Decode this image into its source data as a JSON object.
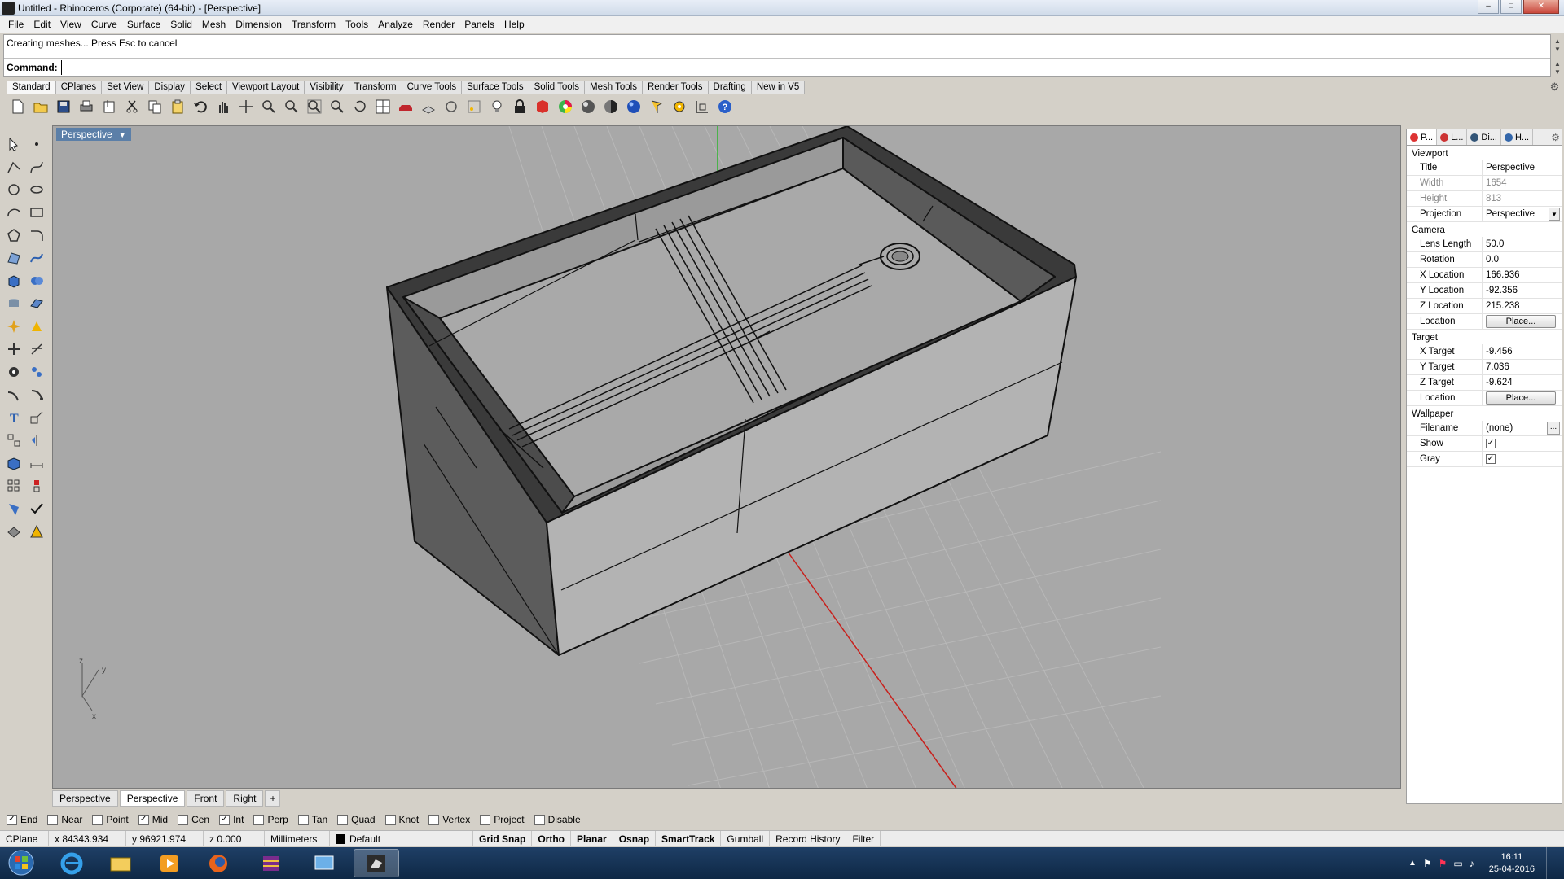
{
  "window": {
    "title": "Untitled - Rhinoceros (Corporate) (64-bit) - [Perspective]",
    "minimize": "–",
    "maximize": "□",
    "close": "✕"
  },
  "menu": [
    "File",
    "Edit",
    "View",
    "Curve",
    "Surface",
    "Solid",
    "Mesh",
    "Dimension",
    "Transform",
    "Tools",
    "Analyze",
    "Render",
    "Panels",
    "Help"
  ],
  "command": {
    "history": "Creating meshes... Press Esc to cancel",
    "prompt_label": "Command:",
    "input_value": ""
  },
  "toolbar_tabs": [
    "Standard",
    "CPlanes",
    "Set View",
    "Display",
    "Select",
    "Viewport Layout",
    "Visibility",
    "Transform",
    "Curve Tools",
    "Surface Tools",
    "Solid Tools",
    "Mesh Tools",
    "Render Tools",
    "Drafting",
    "New in V5"
  ],
  "toolbar_icons": [
    "new-file-icon",
    "open-file-icon",
    "save-icon",
    "print-icon",
    "import-icon",
    "cut-icon",
    "copy-icon",
    "paste-icon",
    "undo-icon",
    "pan-hand-icon",
    "move-view-icon",
    "zoom-window-icon",
    "zoom-dynamic-icon",
    "zoom-extents-icon",
    "zoom-selected-icon",
    "rotate-view-icon",
    "four-viewports-icon",
    "car-icon",
    "grid-icon",
    "circle-icon",
    "points-icon",
    "light-bulb-icon",
    "lock-icon",
    "layer-book-icon",
    "color-wheel-icon",
    "shade-sphere-icon",
    "render-sphere-icon",
    "blue-sphere-icon",
    "flag-icon",
    "gear-settings-icon",
    "grid-snap-icon",
    "help-icon"
  ],
  "left_toolbar_icons": [
    [
      "select-arrow-icon",
      "point-icon"
    ],
    [
      "polyline-icon",
      "curve-icon"
    ],
    [
      "circle-tool-icon",
      "ellipse-icon"
    ],
    [
      "arc-icon",
      "rectangle-icon"
    ],
    [
      "polygon-icon",
      "fillet-curve-icon"
    ],
    [
      "surface-icon",
      "loft-icon"
    ],
    [
      "box-icon",
      "union-icon"
    ],
    [
      "cylinder-icon",
      "plane-icon"
    ],
    [
      "explode-icon",
      "burst-icon"
    ],
    [
      "split-icon",
      "trim-icon"
    ],
    [
      "boolean-icon",
      "array-icon"
    ],
    [
      "sweep-icon",
      "revolve-icon"
    ],
    [
      "text-icon",
      "scale-icon"
    ],
    [
      "group-icon",
      "mirror-icon"
    ],
    [
      "mesh-icon",
      "dimension-icon"
    ],
    [
      "array-grid-icon",
      "orient-icon"
    ],
    [
      "analyze-icon",
      "check-icon"
    ],
    [
      "render-icon",
      "shade-icon"
    ]
  ],
  "viewport": {
    "label": "Perspective",
    "dropdown": "▼",
    "axis_z": "z",
    "axis_y": "y",
    "axis_x": "x"
  },
  "viewport_tabs": [
    "Perspective",
    "Perspective",
    "Front",
    "Right"
  ],
  "viewport_tab_add": "+",
  "panel": {
    "tabs": [
      {
        "label": "P...",
        "color": "#d33"
      },
      {
        "label": "L...",
        "color": "#c33"
      },
      {
        "label": "Di...",
        "color": "#357"
      },
      {
        "label": "H...",
        "color": "#36a"
      }
    ],
    "sections": {
      "viewport": "Viewport",
      "camera": "Camera",
      "target": "Target",
      "wallpaper": "Wallpaper"
    },
    "viewport_props": {
      "title_label": "Title",
      "title_value": "Perspective",
      "width_label": "Width",
      "width_value": "1654",
      "height_label": "Height",
      "height_value": "813",
      "projection_label": "Projection",
      "projection_value": "Perspective"
    },
    "camera_props": {
      "lens_label": "Lens Length",
      "lens_value": "50.0",
      "rotation_label": "Rotation",
      "rotation_value": "0.0",
      "xloc_label": "X Location",
      "xloc_value": "166.936",
      "yloc_label": "Y Location",
      "yloc_value": "-92.356",
      "zloc_label": "Z Location",
      "zloc_value": "215.238",
      "location_label": "Location",
      "place_button": "Place..."
    },
    "target_props": {
      "xt_label": "X Target",
      "xt_value": "-9.456",
      "yt_label": "Y Target",
      "yt_value": "7.036",
      "zt_label": "Z Target",
      "zt_value": "-9.624",
      "location_label": "Location",
      "place_button": "Place..."
    },
    "wallpaper_props": {
      "filename_label": "Filename",
      "filename_value": "(none)",
      "browse_button": "...",
      "show_label": "Show",
      "show_checked": "✓",
      "gray_label": "Gray",
      "gray_checked": "✓"
    }
  },
  "osnap": [
    {
      "label": "End",
      "check": "✓"
    },
    {
      "label": "Near",
      "check": ""
    },
    {
      "label": "Point",
      "check": ""
    },
    {
      "label": "Mid",
      "check": "✓"
    },
    {
      "label": "Cen",
      "check": ""
    },
    {
      "label": "Int",
      "check": "✓"
    },
    {
      "label": "Perp",
      "check": ""
    },
    {
      "label": "Tan",
      "check": ""
    },
    {
      "label": "Quad",
      "check": ""
    },
    {
      "label": "Knot",
      "check": ""
    },
    {
      "label": "Vertex",
      "check": ""
    },
    {
      "label": "Project",
      "check": ""
    },
    {
      "label": "Disable",
      "check": ""
    }
  ],
  "status": {
    "cplane": "CPlane",
    "x": "x 84343.934",
    "y": "y 96921.974",
    "z": "z 0.000",
    "units": "Millimeters",
    "layer": "Default",
    "grid_snap": "Grid Snap",
    "ortho": "Ortho",
    "planar": "Planar",
    "osnap": "Osnap",
    "smarttrack": "SmartTrack",
    "gumball": "Gumball",
    "record_history": "Record History",
    "filter": "Filter"
  },
  "taskbar": {
    "time": "16:11",
    "date": "25-04-2016"
  }
}
